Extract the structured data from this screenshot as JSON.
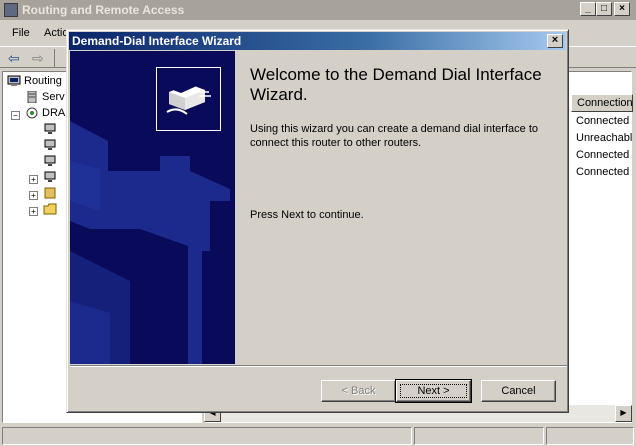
{
  "main_window": {
    "title": "Routing and Remote Access",
    "caption_buttons": [
      "_",
      "□",
      "×"
    ]
  },
  "menu": {
    "file": "File",
    "action": "Actio"
  },
  "tree": {
    "items": [
      {
        "label": "Routing"
      },
      {
        "label": "Serv"
      },
      {
        "label": "DRA"
      }
    ]
  },
  "list": {
    "column_header": "Connection",
    "rows": [
      "Connected",
      "Unreachabl",
      "Connected",
      "Connected"
    ]
  },
  "wizard": {
    "title": "Demand-Dial Interface Wizard",
    "close_label": "×",
    "heading": "Welcome to the Demand Dial Interface Wizard.",
    "description": "Using this wizard you can create a demand dial interface to connect this router to other routers.",
    "continue_hint": "Press Next to continue.",
    "buttons": {
      "back": "< Back",
      "next": "Next >",
      "cancel": "Cancel"
    }
  },
  "colors": {
    "wizard_titlebar": "#0a246a",
    "banner_background": "#0a0a5a",
    "face": "#d4d0c8"
  },
  "icons": [
    "back-arrow-icon",
    "forward-arrow-icon",
    "computer-icon",
    "server-icon",
    "router-icon",
    "network-interface-icon",
    "folder-icon",
    "wizard-modem-icon"
  ]
}
